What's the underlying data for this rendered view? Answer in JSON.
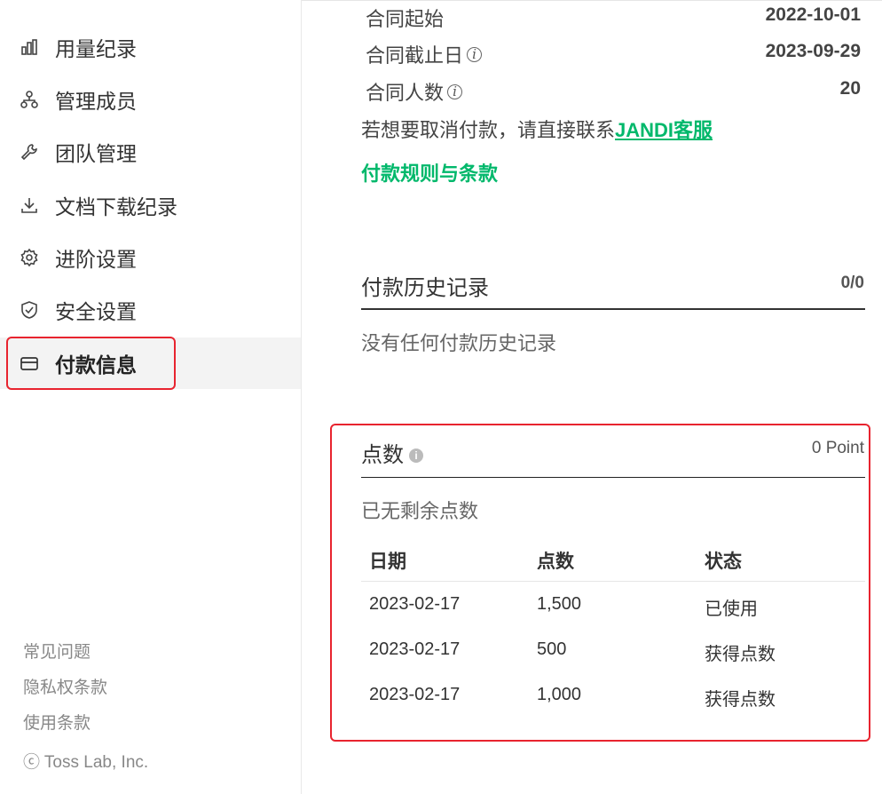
{
  "sidebar": {
    "items": [
      {
        "label": "用量纪录",
        "icon": "bar-chart-icon"
      },
      {
        "label": "管理成员",
        "icon": "org-chart-icon"
      },
      {
        "label": "团队管理",
        "icon": "wrench-icon"
      },
      {
        "label": "文档下载纪录",
        "icon": "download-icon"
      },
      {
        "label": "进阶设置",
        "icon": "gear-icon"
      },
      {
        "label": "安全设置",
        "icon": "shield-icon"
      },
      {
        "label": "付款信息",
        "icon": "credit-card-icon",
        "active": true
      }
    ],
    "footer": {
      "faq": "常见问题",
      "privacy": "隐私权条款",
      "terms": "使用条款",
      "copyright": "ⓒ Toss Lab, Inc."
    }
  },
  "contract": {
    "start_label": "合同起始",
    "start_value": "2022-10-01",
    "end_label": "合同截止日",
    "end_value": "2023-09-29",
    "people_label": "合同人数",
    "people_value": "20",
    "info_glyph": "i"
  },
  "cancel": {
    "text": "若想要取消付款，请直接联系",
    "link": "JANDI客服"
  },
  "terms_link": "付款规则与条款",
  "history": {
    "title": "付款历史记录",
    "count": "0/0",
    "empty": "没有任何付款历史记录"
  },
  "points": {
    "title": "点数",
    "info_glyph": "i",
    "total": "0 Point",
    "empty": "已无剩余点数",
    "columns": [
      "日期",
      "点数",
      "状态"
    ],
    "rows": [
      [
        "2023-02-17",
        "1,500",
        "已使用"
      ],
      [
        "2023-02-17",
        "500",
        "获得点数"
      ],
      [
        "2023-02-17",
        "1,000",
        "获得点数"
      ]
    ]
  },
  "colors": {
    "accent": "#00b86b",
    "highlight": "#e8242f"
  }
}
